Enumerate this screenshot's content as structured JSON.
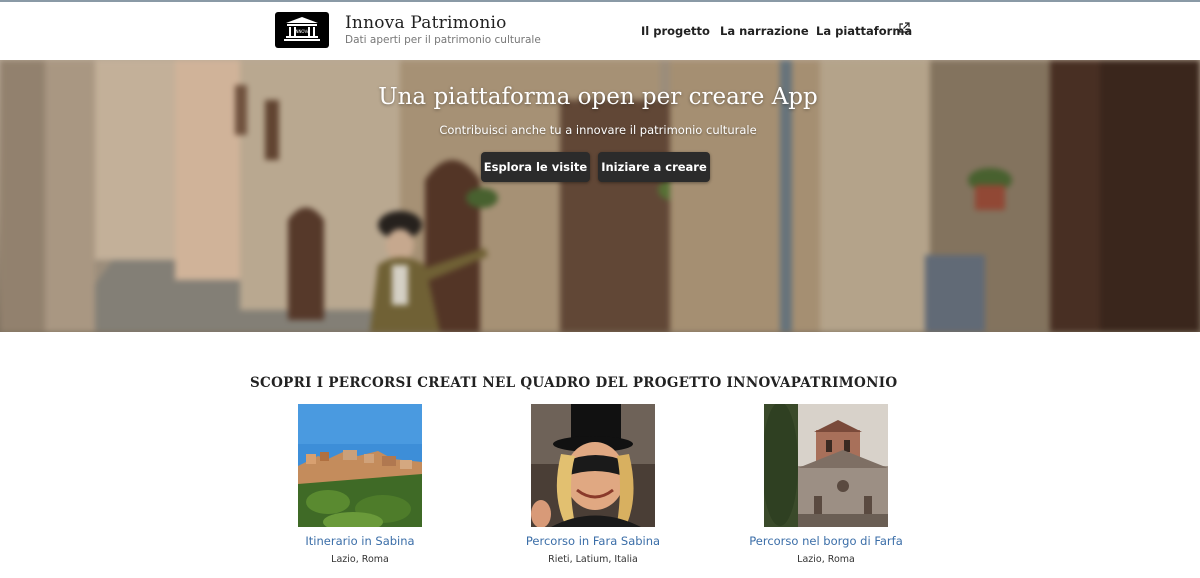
{
  "header": {
    "brand_title": "Innova Patrimonio",
    "brand_subtitle": "Dati aperti per il patrimonio culturale",
    "nav": [
      {
        "label": "Il progetto"
      },
      {
        "label": "La narrazione"
      },
      {
        "label": "La piattaforma",
        "icon": "external-link-icon"
      }
    ]
  },
  "hero": {
    "title": "Una piattaforma open per creare App",
    "subtitle": "Contribuisci anche tu a innovare il patrimonio culturale",
    "buttons": [
      {
        "label": "Esplora le visite"
      },
      {
        "label": "Iniziare a creare"
      }
    ]
  },
  "section": {
    "title": "SCOPRI I PERCORSI CREATI NEL QUADRO DEL PROGETTO INNOVAPATRIMONIO",
    "cards": [
      {
        "title": "Itinerario in Sabina",
        "location": "Lazio, Roma"
      },
      {
        "title": "Percorso in Fara Sabina",
        "location": "Rieti, Latium, Italia"
      },
      {
        "title": "Percorso nel borgo di Farfa",
        "location": "Lazio, Roma"
      }
    ]
  },
  "colors": {
    "link": "#3b6ea8",
    "button_bg": "#2b2b2b",
    "logo_bg": "#000000"
  }
}
